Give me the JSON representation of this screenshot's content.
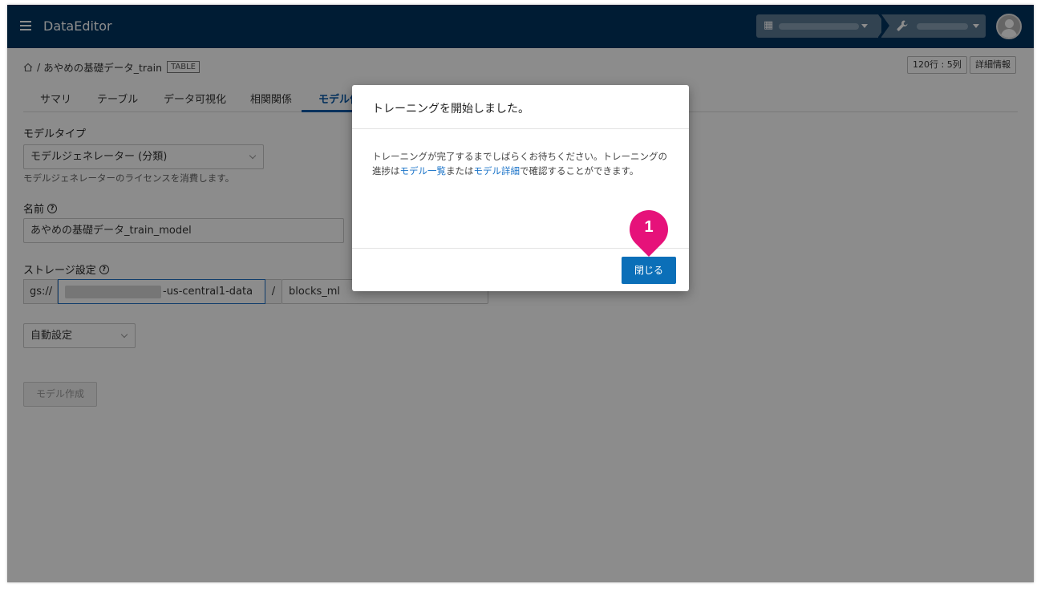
{
  "app": {
    "title": "DataEditor"
  },
  "breadcrumb": {
    "separator": "/",
    "dataset": "あやめの基礎データ_train",
    "type_badge": "TABLE"
  },
  "header_chips": {
    "size": "120行 : 5列",
    "details": "詳細情報"
  },
  "tabs": [
    {
      "label": "サマリ"
    },
    {
      "label": "テーブル"
    },
    {
      "label": "データ可視化"
    },
    {
      "label": "相関関係"
    },
    {
      "label": "モデル作"
    }
  ],
  "form": {
    "model_type_label": "モデルタイプ",
    "model_type_value": "モデルジェネレーター (分類)",
    "model_type_hint": "モデルジェネレーターのライセンスを消費します。",
    "name_label": "名前",
    "name_value": "あやめの基礎データ_train_model",
    "storage_label": "ストレージ設定",
    "storage_prefix": "gs://",
    "storage_bucket_suffix": "-us-central1-data",
    "storage_slash": "/",
    "storage_path": "blocks_ml",
    "auto_value": "自動設定",
    "create_button": "モデル作成"
  },
  "modal": {
    "title": "トレーニングを開始しました。",
    "body_1": "トレーニングが完了するまでしばらくお待ちください。トレーニングの進捗は",
    "link_1": "モデル一覧",
    "body_2": "または",
    "link_2": "モデル詳細",
    "body_3": "で確認することができます。",
    "close_button": "閉じる"
  },
  "step_marker": "1",
  "colors": {
    "header": "#003460",
    "primary": "#0b6fb8",
    "link": "#1a73c8",
    "marker": "#e6127a"
  }
}
